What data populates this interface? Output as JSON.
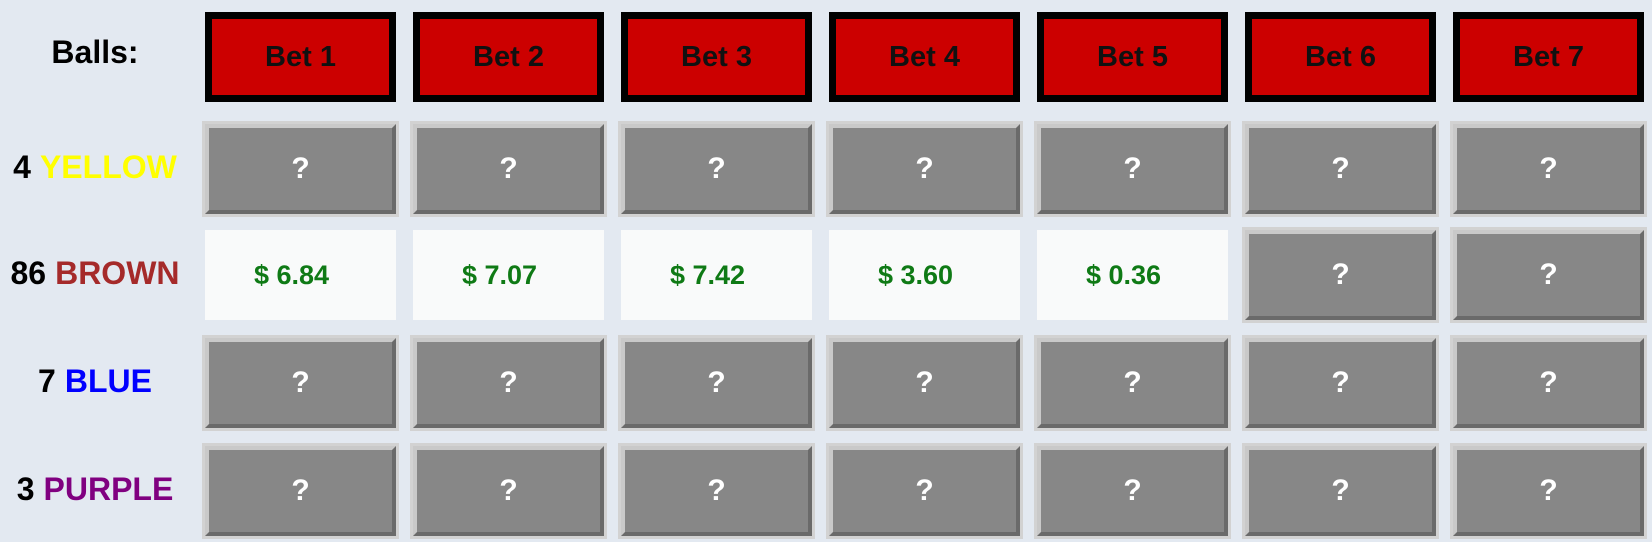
{
  "header": {
    "balls_label": "Balls:",
    "bets": [
      "Bet 1",
      "Bet 2",
      "Bet 3",
      "Bet 4",
      "Bet 5",
      "Bet 6",
      "Bet 7"
    ]
  },
  "rows": [
    {
      "count": "4",
      "color_name": "YELLOW",
      "color": "#ffff00",
      "cells": [
        "?",
        "?",
        "?",
        "?",
        "?",
        "?",
        "?"
      ],
      "revealed": [
        false,
        false,
        false,
        false,
        false,
        false,
        false
      ]
    },
    {
      "count": "86",
      "color_name": "BROWN",
      "color": "#a52a2a",
      "cells": [
        "$ 6.84",
        "$ 7.07",
        "$ 7.42",
        "$ 3.60",
        "$ 0.36",
        "?",
        "?"
      ],
      "revealed": [
        true,
        true,
        true,
        true,
        true,
        false,
        false
      ]
    },
    {
      "count": "7",
      "color_name": "BLUE",
      "color": "#0000ff",
      "cells": [
        "?",
        "?",
        "?",
        "?",
        "?",
        "?",
        "?"
      ],
      "revealed": [
        false,
        false,
        false,
        false,
        false,
        false,
        false
      ]
    },
    {
      "count": "3",
      "color_name": "PURPLE",
      "color": "#800080",
      "cells": [
        "?",
        "?",
        "?",
        "?",
        "?",
        "?",
        "?"
      ],
      "revealed": [
        false,
        false,
        false,
        false,
        false,
        false,
        false
      ]
    }
  ]
}
